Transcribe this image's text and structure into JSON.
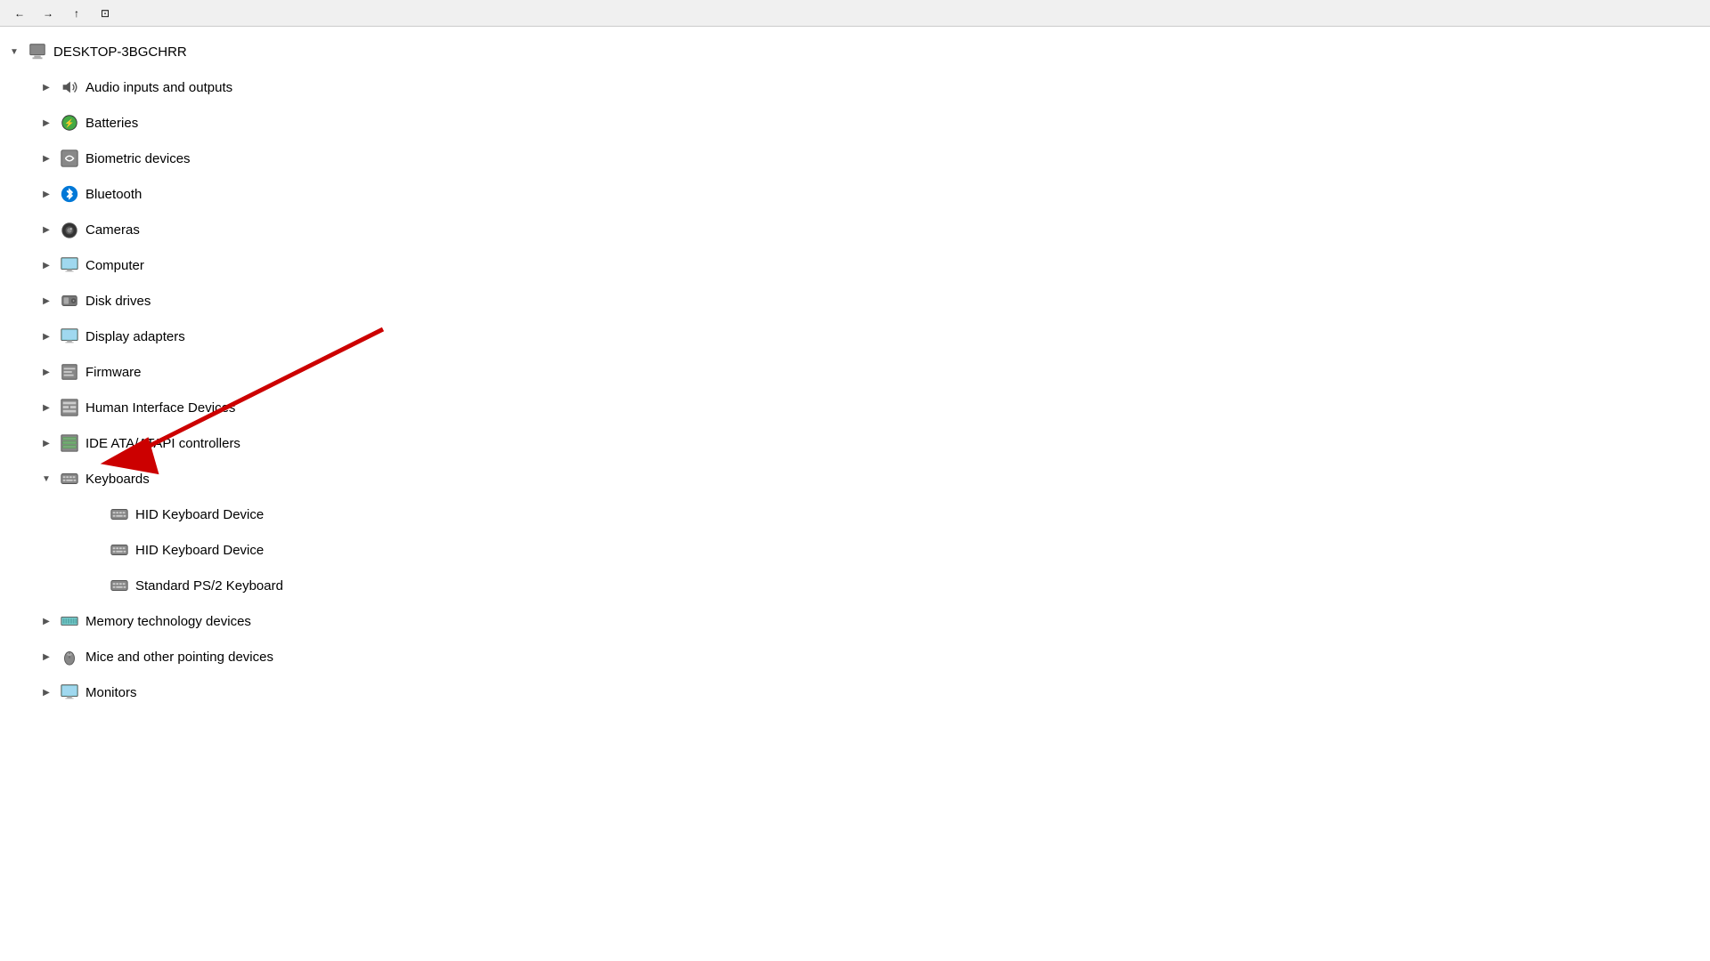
{
  "toolbar": {
    "buttons": [
      "←",
      "→",
      "↑",
      "⊡"
    ]
  },
  "tree": {
    "root": {
      "label": "DESKTOP-3BGCHRR",
      "expanded": true,
      "icon": "computer-icon"
    },
    "items": [
      {
        "id": "audio",
        "label": "Audio inputs and outputs",
        "icon": "speaker-icon",
        "level": 1,
        "expanded": false,
        "hasChildren": true
      },
      {
        "id": "batteries",
        "label": "Batteries",
        "icon": "battery-icon",
        "level": 1,
        "expanded": false,
        "hasChildren": true
      },
      {
        "id": "biometric",
        "label": "Biometric devices",
        "icon": "biometric-icon",
        "level": 1,
        "expanded": false,
        "hasChildren": true
      },
      {
        "id": "bluetooth",
        "label": "Bluetooth",
        "icon": "bluetooth-icon",
        "level": 1,
        "expanded": false,
        "hasChildren": true
      },
      {
        "id": "cameras",
        "label": "Cameras",
        "icon": "camera-icon",
        "level": 1,
        "expanded": false,
        "hasChildren": true
      },
      {
        "id": "computer",
        "label": "Computer",
        "icon": "monitor-icon",
        "level": 1,
        "expanded": false,
        "hasChildren": true
      },
      {
        "id": "diskdrives",
        "label": "Disk drives",
        "icon": "disk-icon",
        "level": 1,
        "expanded": false,
        "hasChildren": true
      },
      {
        "id": "displayadapters",
        "label": "Display adapters",
        "icon": "display-icon",
        "level": 1,
        "expanded": false,
        "hasChildren": true
      },
      {
        "id": "firmware",
        "label": "Firmware",
        "icon": "firmware-icon",
        "level": 1,
        "expanded": false,
        "hasChildren": true
      },
      {
        "id": "hid",
        "label": "Human Interface Devices",
        "icon": "hid-icon",
        "level": 1,
        "expanded": false,
        "hasChildren": true
      },
      {
        "id": "ide",
        "label": "IDE ATA/ATAPI controllers",
        "icon": "ide-icon",
        "level": 1,
        "expanded": false,
        "hasChildren": true
      },
      {
        "id": "keyboards",
        "label": "Keyboards",
        "icon": "keyboard-icon",
        "level": 1,
        "expanded": true,
        "hasChildren": true
      },
      {
        "id": "hid-kbd-1",
        "label": "HID Keyboard Device",
        "icon": "keyboard-device-icon",
        "level": 2,
        "expanded": false,
        "hasChildren": false
      },
      {
        "id": "hid-kbd-2",
        "label": "HID Keyboard Device",
        "icon": "keyboard-device-icon",
        "level": 2,
        "expanded": false,
        "hasChildren": false
      },
      {
        "id": "ps2-kbd",
        "label": "Standard PS/2 Keyboard",
        "icon": "keyboard-device-icon",
        "level": 2,
        "expanded": false,
        "hasChildren": false
      },
      {
        "id": "memory",
        "label": "Memory technology devices",
        "icon": "memory-icon",
        "level": 1,
        "expanded": false,
        "hasChildren": true
      },
      {
        "id": "mice",
        "label": "Mice and other pointing devices",
        "icon": "mouse-icon",
        "level": 1,
        "expanded": false,
        "hasChildren": true
      },
      {
        "id": "monitors",
        "label": "Monitors",
        "icon": "monitor2-icon",
        "level": 1,
        "expanded": false,
        "hasChildren": true
      }
    ]
  }
}
